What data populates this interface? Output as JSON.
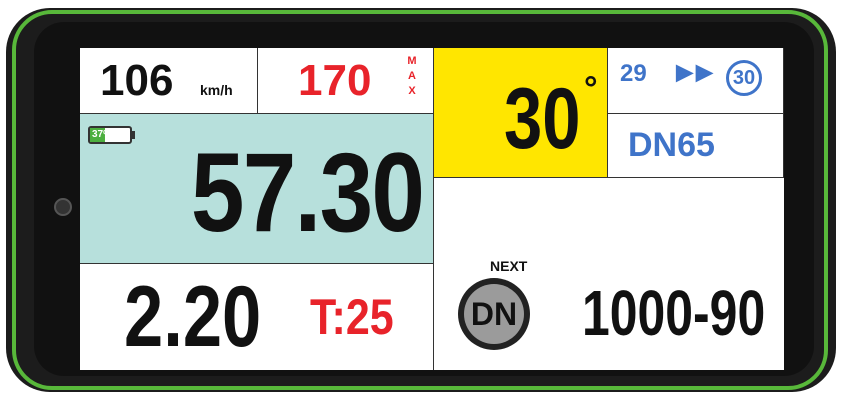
{
  "speed": {
    "value": "106",
    "unit": "km/h"
  },
  "max": {
    "value": "170",
    "label": "MAX"
  },
  "battery": {
    "percent": "37%"
  },
  "distance": {
    "value": "57.30"
  },
  "angle": {
    "value": "30"
  },
  "speed_limits": {
    "from": "29",
    "to": "30"
  },
  "section": {
    "code": "DN65"
  },
  "partial": {
    "value": "2.20"
  },
  "timer": {
    "value": "T:25"
  },
  "next": {
    "label": "NEXT",
    "badge": "DN",
    "value": "1000-90"
  },
  "colors": {
    "accent_yellow": "#ffe600",
    "panel_teal": "#b7e0dc",
    "red": "#e8232a",
    "blue": "#3f74c9",
    "green_bezel": "#58b83a"
  }
}
